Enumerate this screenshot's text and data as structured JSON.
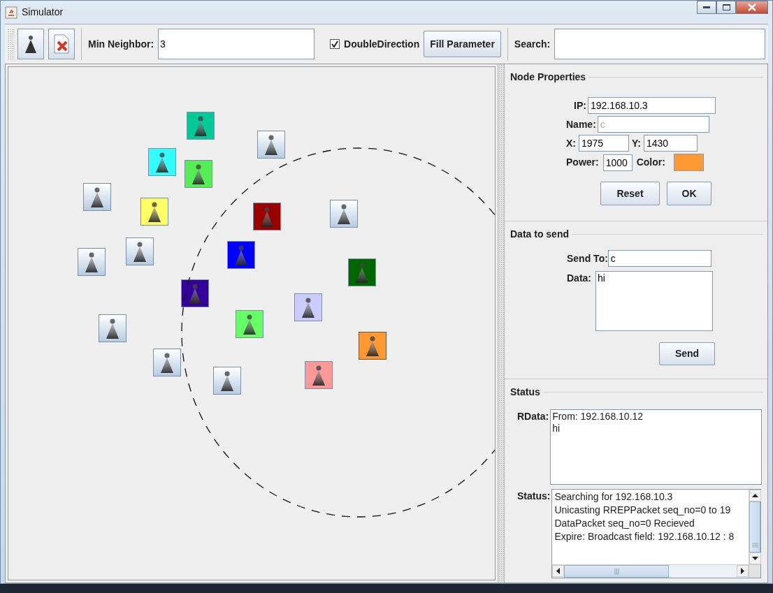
{
  "window": {
    "title": "Simulator"
  },
  "toolbar": {
    "min_neighbor": {
      "label": "Min Neighbor:",
      "value": "3"
    },
    "double_direction": {
      "label": "DoubleDirection",
      "checked": true
    },
    "fill_button": "Fill Parameter",
    "search": {
      "label": "Search:"
    }
  },
  "nodes": [
    {
      "kind": "colored",
      "color": "#00c896",
      "selected": false
    },
    {
      "kind": "plain",
      "selected": false
    },
    {
      "kind": "colored",
      "color": "#33ffff",
      "selected": false
    },
    {
      "kind": "colored",
      "color": "#55ee55",
      "selected": false
    },
    {
      "kind": "plain",
      "selected": false
    },
    {
      "kind": "colored",
      "color": "#ffff66",
      "selected": false
    },
    {
      "kind": "colored",
      "color": "#990000",
      "selected": false
    },
    {
      "kind": "plain",
      "selected": false
    },
    {
      "kind": "plain",
      "selected": false
    },
    {
      "kind": "colored",
      "color": "#0000ff",
      "selected": false
    },
    {
      "kind": "plain",
      "selected": false
    },
    {
      "kind": "colored",
      "color": "#006600",
      "selected": false
    },
    {
      "kind": "colored",
      "color": "#330099",
      "selected": false
    },
    {
      "kind": "colored",
      "color": "#ccccff",
      "selected": false
    },
    {
      "kind": "colored",
      "color": "#66ff66",
      "selected": false
    },
    {
      "kind": "plain",
      "selected": false
    },
    {
      "kind": "colored",
      "color": "#ff9933",
      "selected": true
    },
    {
      "kind": "plain",
      "selected": false
    },
    {
      "kind": "colored",
      "color": "#ff9999",
      "selected": false
    },
    {
      "kind": "plain",
      "selected": false
    }
  ],
  "node_properties": {
    "title": "Node Properties",
    "ip": {
      "label": "IP:",
      "value": "192.168.10.3"
    },
    "name": {
      "label": "Name:",
      "value": "c",
      "disabled": true
    },
    "x": {
      "label": "X:",
      "value": "1975"
    },
    "y": {
      "label": "Y:",
      "value": "1430"
    },
    "power": {
      "label": "Power:",
      "value": "1000"
    },
    "color": {
      "label": "Color:",
      "color": "#ff9933"
    },
    "buttons": [
      "Reset",
      "OK"
    ]
  },
  "data_to_send": {
    "title": "Data to send",
    "send_to": {
      "label": "Send To:",
      "value": "c"
    },
    "data": {
      "label": "Data:",
      "value": "hi"
    },
    "button": "Send"
  },
  "status": {
    "title": "Status",
    "rdata": {
      "label": "RData:",
      "lines": [
        "From: 192.168.10.12",
        "hi"
      ]
    },
    "log": {
      "label": "Status:",
      "lines": [
        "Searching for 192.168.10.3",
        "Unicasting RREPPacket seq_no=0 to 19",
        "DataPacket seq_no=0 Recieved",
        "Expire: Broadcast field: 192.168.10.12 : 8"
      ]
    }
  }
}
